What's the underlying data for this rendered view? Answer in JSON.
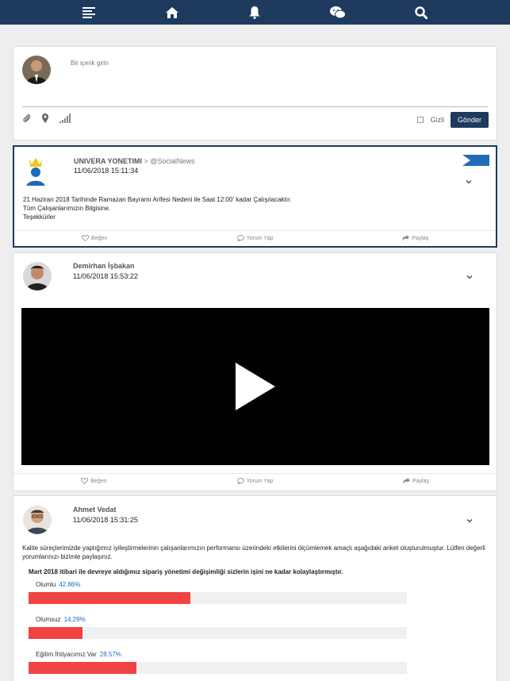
{
  "nav": {
    "icons": [
      "menu-icon",
      "home-icon",
      "bell-icon",
      "wechat-icon",
      "search-icon"
    ]
  },
  "composer": {
    "placeholder": "Bir içerik girin",
    "private_label": "Gizli",
    "send_label": "Gönder"
  },
  "posts": [
    {
      "author": "UNIVERA YONETIMI",
      "channel": "> @SocialNews",
      "date": "11/06/2018 15:11:34",
      "lines": [
        "21 Haziran 2018 Tarihinde Ramazan Bayramı Arifesi Nedeni ile Saat 12:00' kadar Çalışılacaktır.",
        "Tüm Çalışanlarımızın Bilgisine.",
        "Teşekkürler"
      ]
    },
    {
      "author": "Demirhan İşbakan",
      "date": "11/06/2018 15:53:22"
    },
    {
      "author": "Ahmet Vedat",
      "date": "11/06/2018 15:31:25",
      "text": "Kalite süreçlerimizde yaptığımız iyileştirmelerinin çalışanlarımızın performansı üzerindeki etkilerini ölçümlemek amaçlı aşağıdaki anket oluşturulmuştur. Lütfen değerli yorumlarınızı bizimle paylaşınız.",
      "question": "Mart 2018 itibari ile devreye aldığımız sipariş yönetimi değişimliği sizlerin işini ne kadar kolaylaştırmıştır.",
      "options": [
        {
          "label": "Olumlu",
          "pct": "42.86%",
          "value": 0.4286
        },
        {
          "label": "Olumsuz",
          "pct": "14.29%",
          "value": 0.1429
        },
        {
          "label": "Eğitim İhtiyacımız Var",
          "pct": "28.57%",
          "value": 0.2857
        }
      ]
    }
  ],
  "actions": {
    "like": "Beğen",
    "comment": "Yorum Yap",
    "share": "Paylaş"
  }
}
